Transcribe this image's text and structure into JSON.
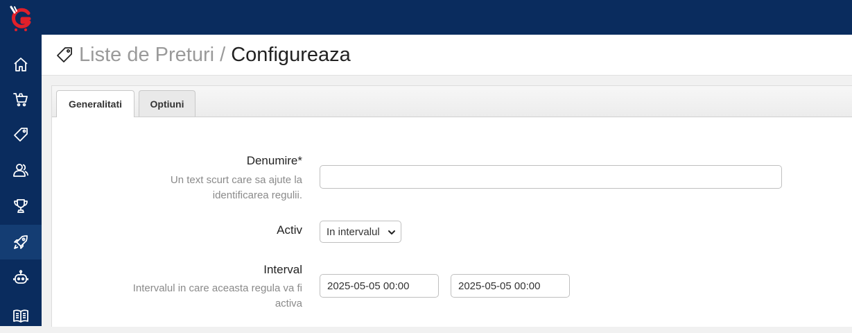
{
  "sidebar": {
    "items": [
      {
        "name": "home-icon"
      },
      {
        "name": "cart-icon"
      },
      {
        "name": "tag-icon"
      },
      {
        "name": "users-icon"
      },
      {
        "name": "trophy-icon"
      },
      {
        "name": "rocket-icon",
        "active": true
      },
      {
        "name": "robot-icon"
      },
      {
        "name": "book-icon"
      }
    ]
  },
  "header": {
    "icon": "tag-icon",
    "crumb": "Liste de Preturi",
    "separator": "/",
    "title": "Configureaza"
  },
  "tabs": [
    {
      "label": "Generalitati",
      "active": true
    },
    {
      "label": "Optiuni",
      "active": false
    }
  ],
  "form": {
    "denumire": {
      "label": "Denumire*",
      "hint_line1": "Un text scurt care sa ajute la",
      "hint_line2": "identificarea regulii.",
      "value": ""
    },
    "activ": {
      "label": "Activ",
      "selected": "In intervalul"
    },
    "interval": {
      "label": "Interval",
      "hint_line1": "Intervalul in care aceasta regula va fi",
      "hint_line2": "activa",
      "start": "2025-05-05 00:00",
      "end": "2025-05-05 00:00"
    }
  },
  "colors": {
    "navy": "#0a2c5e",
    "logo_red": "#e0202a"
  }
}
